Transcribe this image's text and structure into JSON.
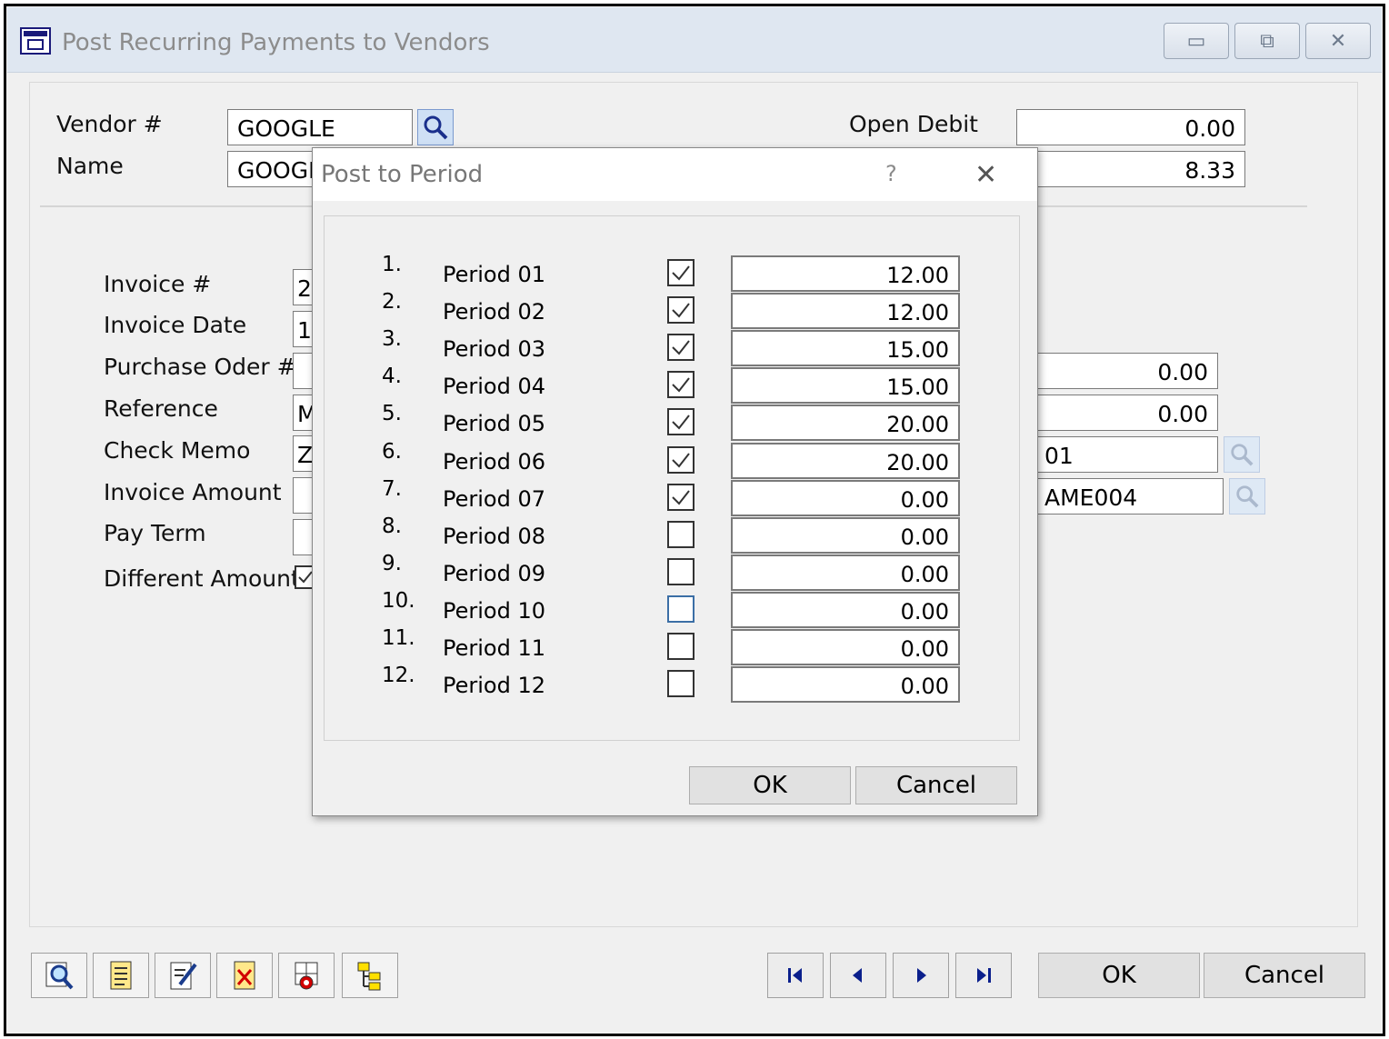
{
  "window": {
    "title": "Post Recurring Payments to Vendors",
    "minimize": "▭",
    "restore": "⧉",
    "close": "✕"
  },
  "form": {
    "vendor_label": "Vendor #",
    "vendor_value": "GOOGLE",
    "name_label": "Name",
    "name_value": "GOOGL",
    "open_debit_label": "Open Debit",
    "open_debit_value": "0.00",
    "second_amount_value": "8.33",
    "invoice_no_label": "Invoice #",
    "invoice_no_value": "2",
    "invoice_date_label": "Invoice Date",
    "invoice_date_value": "1",
    "purchase_order_label": "Purchase Oder #",
    "purchase_order_value": "",
    "reference_label": "Reference",
    "reference_value": "M",
    "check_memo_label": "Check Memo",
    "check_memo_value": "Z",
    "invoice_amount_label": "Invoice Amount",
    "invoice_amount_value": "",
    "pay_term_label": "Pay Term",
    "pay_term_value": "",
    "different_amount_label": "Different Amount",
    "right_amount_1": "0.00",
    "right_amount_2": "0.00",
    "right_code_1": "01",
    "right_code_2": "AME004"
  },
  "toolbar": {
    "icons": [
      "search-tool-icon",
      "document-icon",
      "edit-document-icon",
      "delete-document-icon",
      "calendar-tool-icon",
      "tree-structure-icon"
    ]
  },
  "navigation": {
    "ok_label": "OK",
    "cancel_label": "Cancel"
  },
  "dialog": {
    "title": "Post to Period",
    "help": "?",
    "close": "✕",
    "ok_label": "OK",
    "cancel_label": "Cancel",
    "periods": [
      {
        "num": "1.",
        "name": "Period 01",
        "checked": true,
        "amount": "12.00"
      },
      {
        "num": "2.",
        "name": "Period 02",
        "checked": true,
        "amount": "12.00"
      },
      {
        "num": "3.",
        "name": "Period 03",
        "checked": true,
        "amount": "15.00"
      },
      {
        "num": "4.",
        "name": "Period 04",
        "checked": true,
        "amount": "15.00"
      },
      {
        "num": "5.",
        "name": "Period 05",
        "checked": true,
        "amount": "20.00"
      },
      {
        "num": "6.",
        "name": "Period 06",
        "checked": true,
        "amount": "20.00"
      },
      {
        "num": "7.",
        "name": "Period 07",
        "checked": true,
        "amount": "0.00"
      },
      {
        "num": "8.",
        "name": "Period 08",
        "checked": false,
        "amount": "0.00"
      },
      {
        "num": "9.",
        "name": "Period 09",
        "checked": false,
        "amount": "0.00"
      },
      {
        "num": "10.",
        "name": "Period 10",
        "checked": false,
        "amount": "0.00"
      },
      {
        "num": "11.",
        "name": "Period 11",
        "checked": false,
        "amount": "0.00"
      },
      {
        "num": "12.",
        "name": "Period 12",
        "checked": false,
        "amount": "0.00"
      }
    ]
  }
}
